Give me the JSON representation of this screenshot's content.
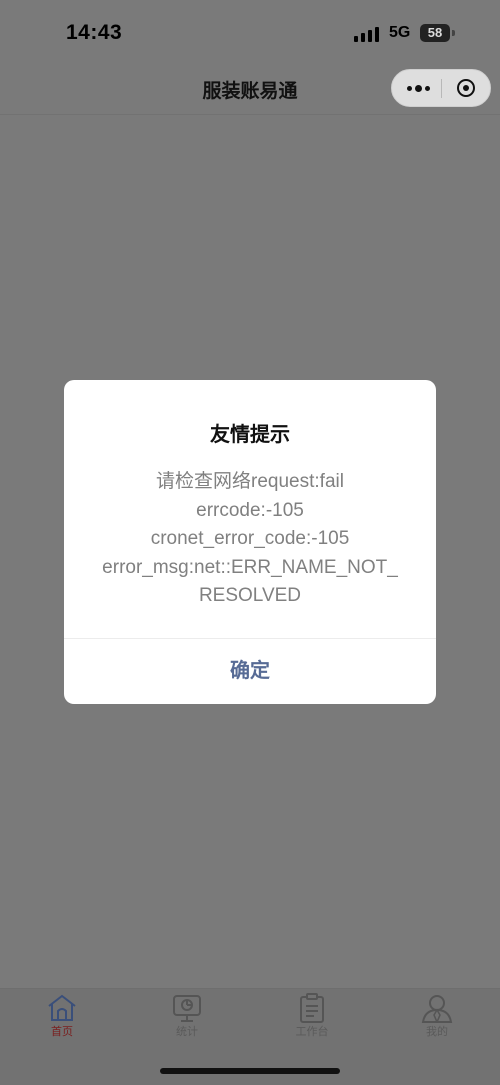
{
  "status_bar": {
    "time": "14:43",
    "network": "5G",
    "battery": "58"
  },
  "nav": {
    "title": "服装账易通"
  },
  "dialog": {
    "title": "友情提示",
    "message_lines": [
      "请检查网络request:fail",
      "errcode:-105",
      "cronet_error_code:-105",
      "error_msg:net::ERR_NAME_NOT_",
      "RESOLVED"
    ],
    "confirm_label": "确定"
  },
  "tabs": [
    {
      "label": "首页",
      "icon": "home-icon",
      "active": true
    },
    {
      "label": "统计",
      "icon": "stats-icon",
      "active": false
    },
    {
      "label": "工作台",
      "icon": "clipboard-icon",
      "active": false
    },
    {
      "label": "我的",
      "icon": "user-icon",
      "active": false
    }
  ],
  "colors": {
    "overlay": "#7a7a7a",
    "dialog_button": "#576b95",
    "active_tab": "#7a2020"
  }
}
